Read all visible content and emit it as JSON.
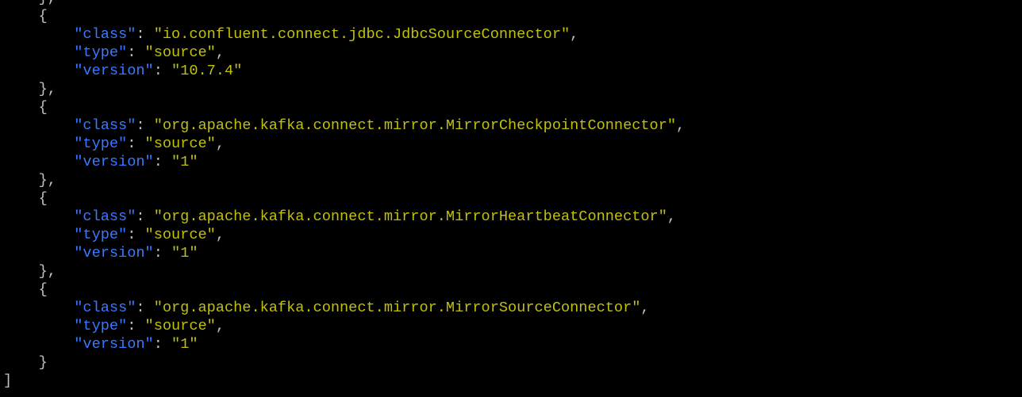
{
  "window": {
    "background": "#000000",
    "colors": {
      "punctuation": "#c0c0c0",
      "key": "#3b78ff",
      "string": "#c1c10a"
    }
  },
  "lines": [
    {
      "indent": "    ",
      "segments": [
        {
          "t": "p",
          "text": "},"
        }
      ]
    },
    {
      "indent": "    ",
      "segments": [
        {
          "t": "p",
          "text": "{"
        }
      ]
    },
    {
      "indent": "        ",
      "segments": [
        {
          "t": "k",
          "text": "\"class\""
        },
        {
          "t": "p",
          "text": ": "
        },
        {
          "t": "s",
          "text": "\"io.confluent.connect.jdbc.JdbcSourceConnector\""
        },
        {
          "t": "p",
          "text": ","
        }
      ]
    },
    {
      "indent": "        ",
      "segments": [
        {
          "t": "k",
          "text": "\"type\""
        },
        {
          "t": "p",
          "text": ": "
        },
        {
          "t": "s",
          "text": "\"source\""
        },
        {
          "t": "p",
          "text": ","
        }
      ]
    },
    {
      "indent": "        ",
      "segments": [
        {
          "t": "k",
          "text": "\"version\""
        },
        {
          "t": "p",
          "text": ": "
        },
        {
          "t": "s",
          "text": "\"10.7.4\""
        }
      ]
    },
    {
      "indent": "    ",
      "segments": [
        {
          "t": "p",
          "text": "},"
        }
      ]
    },
    {
      "indent": "    ",
      "segments": [
        {
          "t": "p",
          "text": "{"
        }
      ]
    },
    {
      "indent": "        ",
      "segments": [
        {
          "t": "k",
          "text": "\"class\""
        },
        {
          "t": "p",
          "text": ": "
        },
        {
          "t": "s",
          "text": "\"org.apache.kafka.connect.mirror.MirrorCheckpointConnector\""
        },
        {
          "t": "p",
          "text": ","
        }
      ]
    },
    {
      "indent": "        ",
      "segments": [
        {
          "t": "k",
          "text": "\"type\""
        },
        {
          "t": "p",
          "text": ": "
        },
        {
          "t": "s",
          "text": "\"source\""
        },
        {
          "t": "p",
          "text": ","
        }
      ]
    },
    {
      "indent": "        ",
      "segments": [
        {
          "t": "k",
          "text": "\"version\""
        },
        {
          "t": "p",
          "text": ": "
        },
        {
          "t": "s",
          "text": "\"1\""
        }
      ]
    },
    {
      "indent": "    ",
      "segments": [
        {
          "t": "p",
          "text": "},"
        }
      ]
    },
    {
      "indent": "    ",
      "segments": [
        {
          "t": "p",
          "text": "{"
        }
      ]
    },
    {
      "indent": "        ",
      "segments": [
        {
          "t": "k",
          "text": "\"class\""
        },
        {
          "t": "p",
          "text": ": "
        },
        {
          "t": "s",
          "text": "\"org.apache.kafka.connect.mirror.MirrorHeartbeatConnector\""
        },
        {
          "t": "p",
          "text": ","
        }
      ]
    },
    {
      "indent": "        ",
      "segments": [
        {
          "t": "k",
          "text": "\"type\""
        },
        {
          "t": "p",
          "text": ": "
        },
        {
          "t": "s",
          "text": "\"source\""
        },
        {
          "t": "p",
          "text": ","
        }
      ]
    },
    {
      "indent": "        ",
      "segments": [
        {
          "t": "k",
          "text": "\"version\""
        },
        {
          "t": "p",
          "text": ": "
        },
        {
          "t": "s",
          "text": "\"1\""
        }
      ]
    },
    {
      "indent": "    ",
      "segments": [
        {
          "t": "p",
          "text": "},"
        }
      ]
    },
    {
      "indent": "    ",
      "segments": [
        {
          "t": "p",
          "text": "{"
        }
      ]
    },
    {
      "indent": "        ",
      "segments": [
        {
          "t": "k",
          "text": "\"class\""
        },
        {
          "t": "p",
          "text": ": "
        },
        {
          "t": "s",
          "text": "\"org.apache.kafka.connect.mirror.MirrorSourceConnector\""
        },
        {
          "t": "p",
          "text": ","
        }
      ]
    },
    {
      "indent": "        ",
      "segments": [
        {
          "t": "k",
          "text": "\"type\""
        },
        {
          "t": "p",
          "text": ": "
        },
        {
          "t": "s",
          "text": "\"source\""
        },
        {
          "t": "p",
          "text": ","
        }
      ]
    },
    {
      "indent": "        ",
      "segments": [
        {
          "t": "k",
          "text": "\"version\""
        },
        {
          "t": "p",
          "text": ": "
        },
        {
          "t": "s",
          "text": "\"1\""
        }
      ]
    },
    {
      "indent": "    ",
      "segments": [
        {
          "t": "p",
          "text": "}"
        }
      ]
    },
    {
      "indent": "",
      "segments": [
        {
          "t": "p",
          "text": "]"
        }
      ]
    }
  ]
}
